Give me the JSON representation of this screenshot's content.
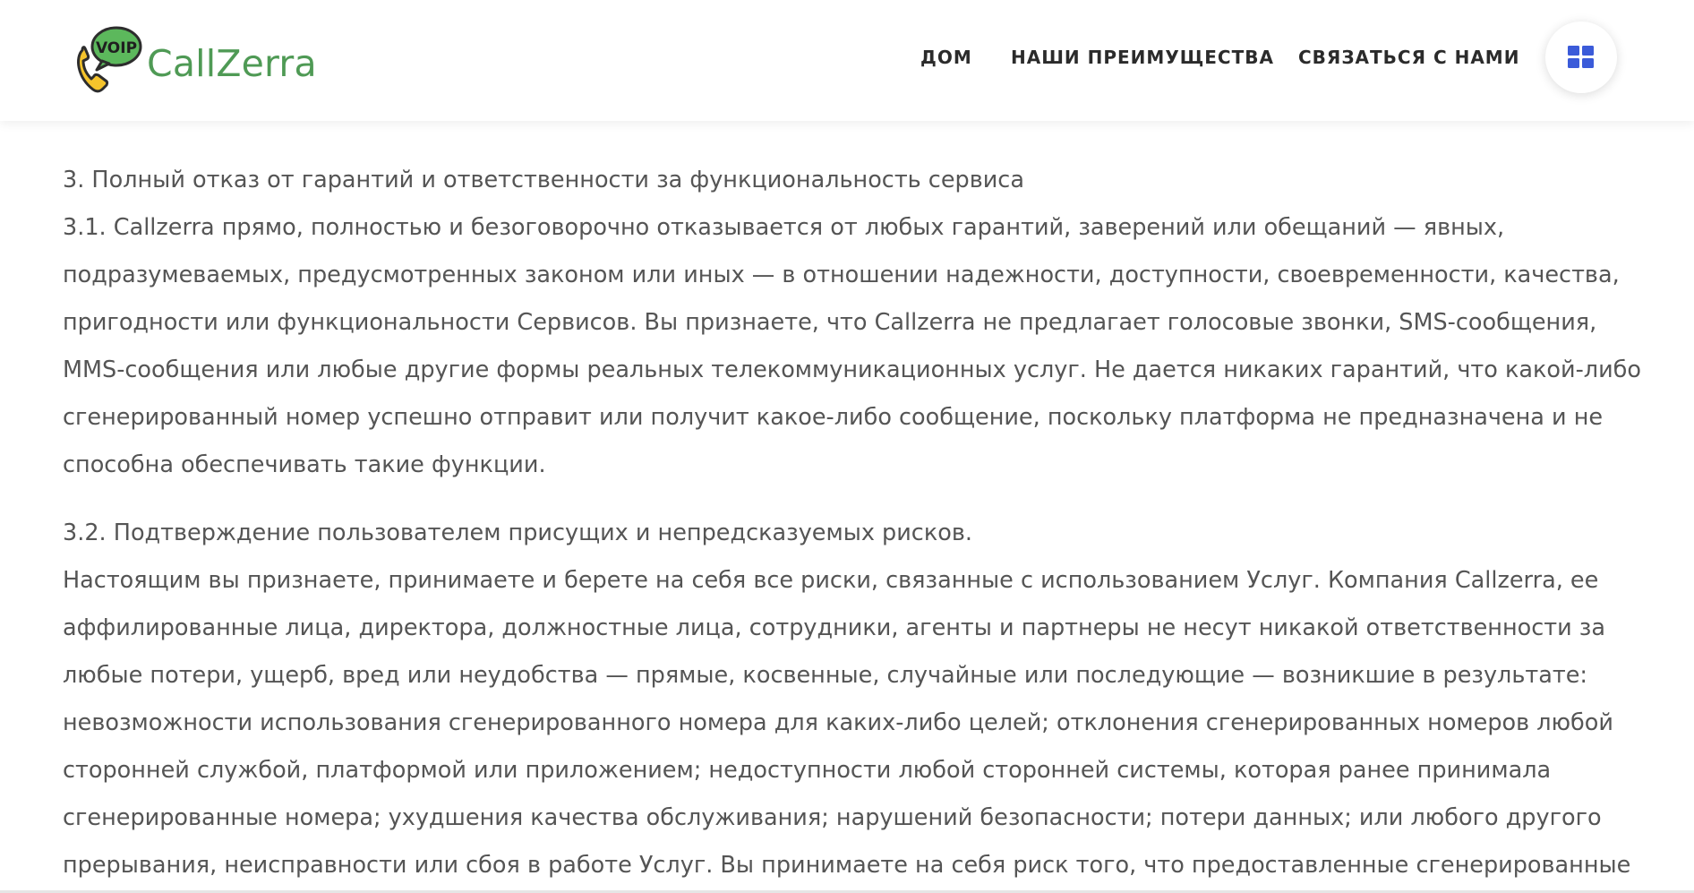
{
  "header": {
    "logo_text": "CallZerra",
    "logo_badge": "VOIP",
    "nav": {
      "home": "ДОМ",
      "advantages": "НАШИ ПРЕИМУЩЕСТВА",
      "contact": "СВЯЗАТЬСЯ С НАМИ"
    },
    "menu_icon": "grid-icon"
  },
  "colors": {
    "brand_green": "#4f9a55",
    "phone_yellow": "#f5c42c",
    "menu_blue": "#3b5bd9",
    "body_text": "#555555",
    "nav_text": "#2b2b2b"
  },
  "content": {
    "lines": [
      "3. Полный отказ от гарантий и ответственности за функциональность сервиса",
      "3.1. Callzerra прямо, полностью и безоговорочно отказывается от любых гарантий, заверений или обещаний — явных,",
      "подразумеваемых, предусмотренных законом или иных — в отношении надежности, доступности, своевременности, качества,",
      "пригодности или функциональности Сервисов. Вы признаете, что Callzerra не предлагает голосовые звонки, SMS-сообщения,",
      "MMS-сообщения или любые другие формы реальных телекоммуникационных услуг. Не дается никаких гарантий, что какой-либо",
      "сгенерированный номер успешно отправит или получит какое-либо сообщение, поскольку платформа не предназначена и не",
      "способна обеспечивать такие функции.",
      "3.2. Подтверждение пользователем присущих и непредсказуемых рисков.",
      "Настоящим вы признаете, принимаете и берете на себя все риски, связанные с использованием Услуг. Компания Callzerra, ее",
      "аффилированные лица, директора, должностные лица, сотрудники, агенты и партнеры не несут никакой ответственности за",
      "любые потери, ущерб, вред или неудобства — прямые, косвенные, случайные или последующие — возникшие в результате:",
      "невозможности использования сгенерированного номера для каких-либо целей; отклонения сгенерированных номеров любой",
      "сторонней службой, платформой или приложением; недоступности любой сторонней системы, которая ранее принимала",
      "сгенерированные номера; ухудшения качества обслуживания; нарушений безопасности; потери данных; или любого другого",
      "прерывания, неисправности или сбоя в работе Услуг. Вы принимаете на себя риск того, что предоставленные сгенерированные"
    ]
  }
}
